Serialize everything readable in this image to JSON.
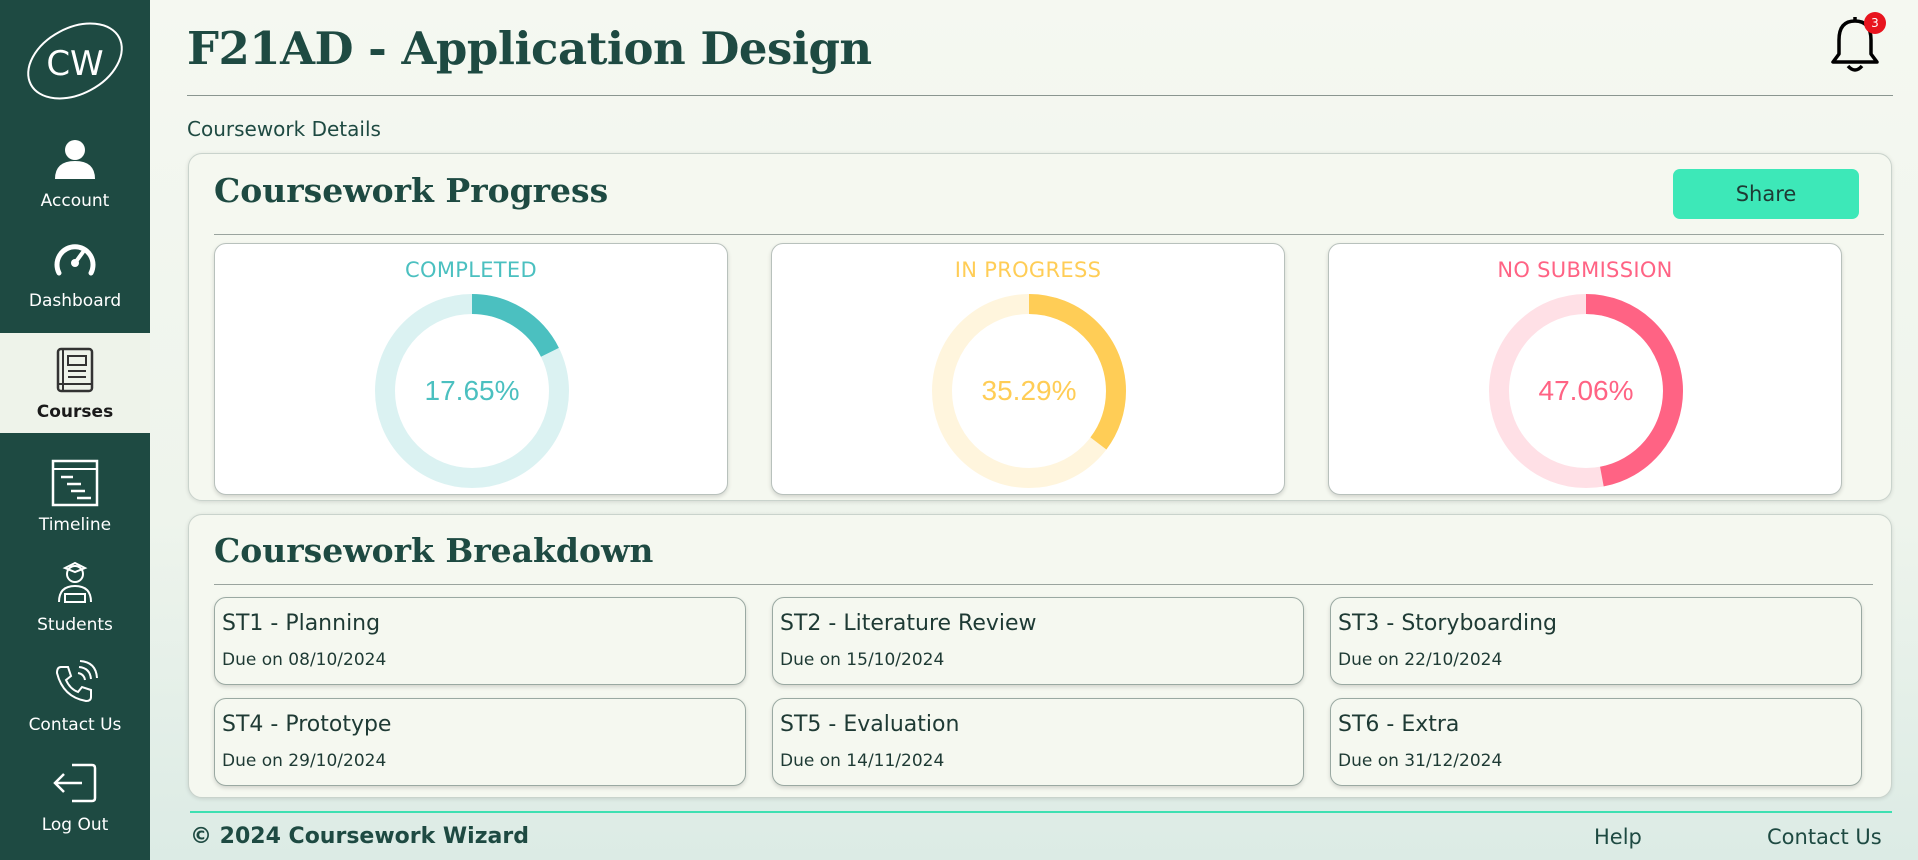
{
  "app": {
    "logo_text": "CW",
    "page_title": "F21AD - Application Design",
    "notifications_count": "3",
    "breadcrumb": "Coursework Details"
  },
  "sidebar": {
    "items": [
      {
        "label": "Account",
        "icon": "user-icon",
        "active": false
      },
      {
        "label": "Dashboard",
        "icon": "speedometer-icon",
        "active": false
      },
      {
        "label": "Courses",
        "icon": "book-icon",
        "active": true
      },
      {
        "label": "Timeline",
        "icon": "timeline-icon",
        "active": false
      },
      {
        "label": "Students",
        "icon": "student-icon",
        "active": false
      },
      {
        "label": "Contact Us",
        "icon": "phone-icon",
        "active": false
      },
      {
        "label": "Log Out",
        "icon": "logout-icon",
        "active": false
      }
    ]
  },
  "progress": {
    "title": "Coursework Progress",
    "share_label": "Share",
    "stats": [
      {
        "label": "COMPLETED",
        "value": "17.65%",
        "fraction": 0.1765,
        "color": "#4bc0c0",
        "track": "#dbf2f2"
      },
      {
        "label": "IN PROGRESS",
        "value": "35.29%",
        "fraction": 0.3529,
        "color": "#ffcd56",
        "track": "#fff5dd"
      },
      {
        "label": "NO SUBMISSION",
        "value": "47.06%",
        "fraction": 0.4706,
        "color": "#ff6384",
        "track": "#ffe0e6"
      }
    ]
  },
  "breakdown": {
    "title": "Coursework Breakdown",
    "tasks": [
      {
        "title": "ST1 - Planning",
        "due": "Due on 08/10/2024"
      },
      {
        "title": "ST2 - Literature Review",
        "due": "Due on 15/10/2024"
      },
      {
        "title": "ST3 - Storyboarding",
        "due": "Due on 22/10/2024"
      },
      {
        "title": "ST4 - Prototype",
        "due": "Due on 29/10/2024"
      },
      {
        "title": "ST5 - Evaluation",
        "due": "Due on 14/11/2024"
      },
      {
        "title": "ST6 - Extra",
        "due": "Due on 31/12/2024"
      }
    ]
  },
  "footer": {
    "copyright": "© 2024 Coursework Wizard",
    "help": "Help",
    "contact": "Contact Us"
  },
  "colors": {
    "sidebar": "#1e4a42",
    "accent": "#3de8b8",
    "badge": "#e8141e"
  }
}
